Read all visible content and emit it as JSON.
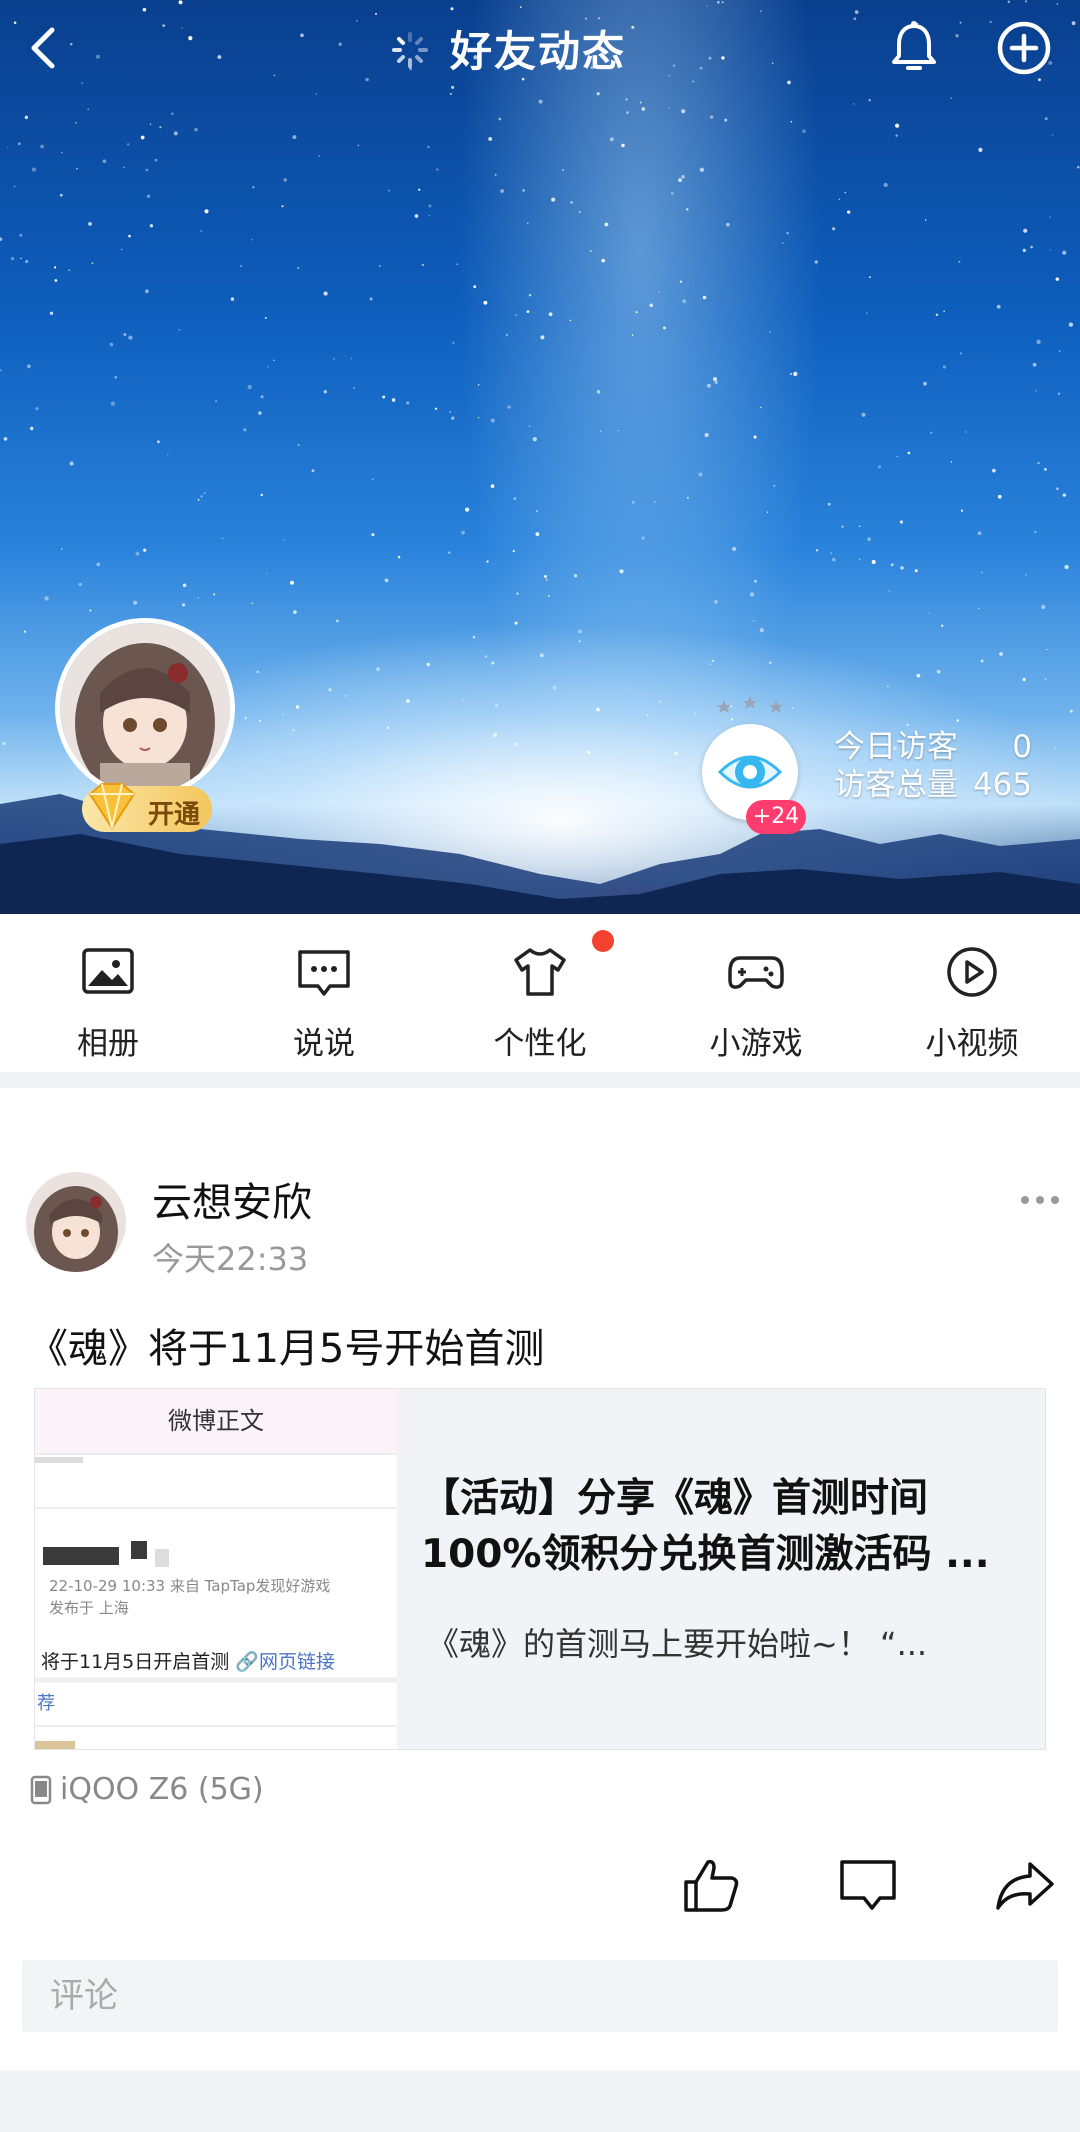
{
  "header": {
    "title": "好友动态",
    "icons": [
      "back-icon",
      "loading-icon",
      "bell-icon",
      "plus-circle-icon"
    ]
  },
  "profile": {
    "vip_label": "开通",
    "visitor_badge": "+24",
    "today_visitors_label": "今日访客",
    "today_visitors_value": "0",
    "total_visitors_label": "访客总量",
    "total_visitors_value": "465"
  },
  "quicknav": {
    "items": [
      {
        "label": "相册",
        "icon": "photo-album-icon"
      },
      {
        "label": "说说",
        "icon": "chat-bubble-icon"
      },
      {
        "label": "个性化",
        "icon": "tshirt-icon"
      },
      {
        "label": "小游戏",
        "icon": "gamepad-icon"
      },
      {
        "label": "小视频",
        "icon": "play-circle-icon"
      }
    ]
  },
  "post": {
    "author": "云想安欣",
    "time": "今天22:33",
    "text": "《魂》将于11月5号开始首测",
    "card": {
      "thumb_header": "微博正文",
      "thumb_meta_line1": "22-10-29 10:33  来自 TapTap发现好游戏",
      "thumb_meta_line2": "发布于 上海",
      "thumb_body": "将于11月5日开启首测",
      "thumb_link": "🔗网页链接",
      "thumb_tab": "荐",
      "title_line1": "【活动】分享《魂》首测时间",
      "title_line2": "100%领积分兑换首测激活码 ...",
      "desc": "《魂》的首测马上要开始啦~！  “..."
    },
    "device": "iQOO Z6 (5G)",
    "comment_placeholder": "评论"
  },
  "colors": {
    "accent_red": "#f5412f",
    "badge_pink": "#ff3d6e",
    "vip_gold": "#f4c65d"
  }
}
